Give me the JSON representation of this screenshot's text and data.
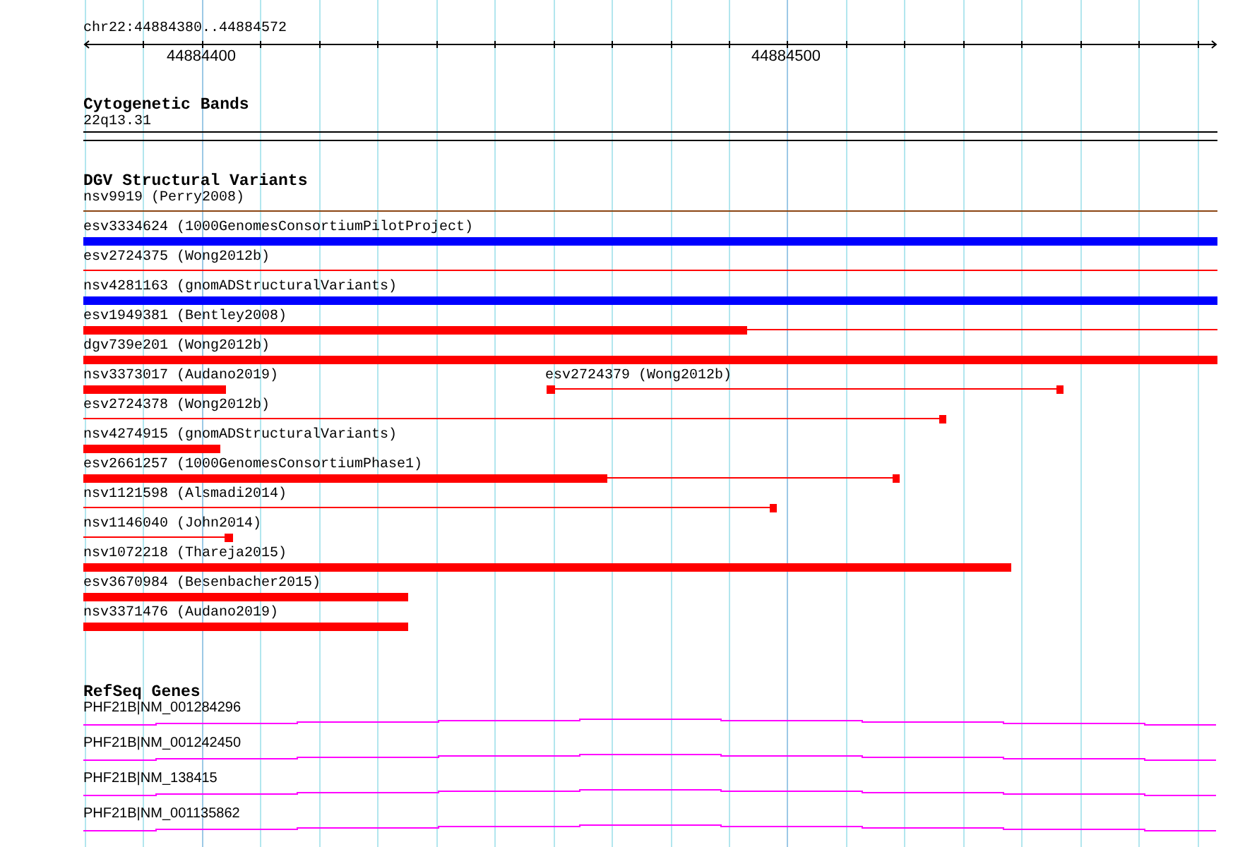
{
  "ruler": {
    "range": "chr22:44884380..44884572",
    "tick_labels": [
      "44884400",
      "44884500"
    ]
  },
  "tracks": [
    {
      "kind": "cytoband",
      "title": "Cytogenetic Bands",
      "bands": [
        {
          "label": "22q13.31"
        }
      ]
    },
    {
      "kind": "variants",
      "title": "DGV Structural Variants",
      "features": [
        {
          "label": "nsv9919 (Perry2008)",
          "color": "#8b4513"
        },
        {
          "label": "esv3334624 (1000GenomesConsortiumPilotProject)",
          "color": "#0000ff"
        },
        {
          "label": "esv2724375 (Wong2012b)",
          "color": "#ff0000"
        },
        {
          "label": "nsv4281163 (gnomADStructuralVariants)",
          "color": "#0000ff"
        },
        {
          "label": "esv1949381 (Bentley2008)",
          "color": "#ff0000"
        },
        {
          "label": "dgv739e201 (Wong2012b)",
          "color": "#ff0000"
        },
        {
          "label": "nsv3373017 (Audano2019)",
          "color": "#ff0000"
        },
        {
          "label": "esv2724379 (Wong2012b)",
          "color": "#ff0000"
        },
        {
          "label": "esv2724378 (Wong2012b)",
          "color": "#ff0000"
        },
        {
          "label": "nsv4274915 (gnomADStructuralVariants)",
          "color": "#ff0000"
        },
        {
          "label": "esv2661257 (1000GenomesConsortiumPhase1)",
          "color": "#ff0000"
        },
        {
          "label": "nsv1121598 (Alsmadi2014)",
          "color": "#ff0000"
        },
        {
          "label": "nsv1146040 (John2014)",
          "color": "#ff0000"
        },
        {
          "label": "nsv1072218 (Thareja2015)",
          "color": "#ff0000"
        },
        {
          "label": "esv3670984 (Besenbacher2015)",
          "color": "#ff0000"
        },
        {
          "label": "nsv3371476 (Audano2019)",
          "color": "#ff0000"
        }
      ]
    },
    {
      "kind": "genes",
      "title": "RefSeq Genes",
      "genes": [
        {
          "label": "PHF21B|NM_001284296"
        },
        {
          "label": "PHF21B|NM_001242450"
        },
        {
          "label": "PHF21B|NM_138415"
        },
        {
          "label": "PHF21B|NM_001135862"
        }
      ]
    }
  ]
}
